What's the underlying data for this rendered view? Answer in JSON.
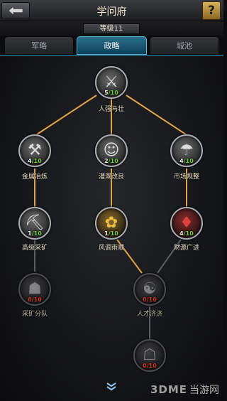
{
  "header": {
    "title": "学问府",
    "back_icon": "back-arrow-icon",
    "help_label": "?"
  },
  "level": {
    "label": "等级11"
  },
  "tabs": [
    {
      "label": "军略",
      "active": false
    },
    {
      "label": "政略",
      "active": true
    },
    {
      "label": "城池",
      "active": false
    }
  ],
  "tree": {
    "nodes": [
      {
        "id": "people",
        "label": "人强马壮",
        "current": "5",
        "max": "10",
        "locked": false,
        "icon": "warrior-portrait-icon"
      },
      {
        "id": "metal",
        "label": "金属冶炼",
        "current": "4",
        "max": "10",
        "locked": false,
        "icon": "smelting-icon"
      },
      {
        "id": "irrigation",
        "label": "灌溉改良",
        "current": "2",
        "max": "10",
        "locked": false,
        "icon": "farmer-icon"
      },
      {
        "id": "market",
        "label": "市场规整",
        "current": "4",
        "max": "10",
        "locked": false,
        "icon": "market-stall-icon"
      },
      {
        "id": "mining",
        "label": "高级采矿",
        "current": "1",
        "max": "10",
        "locked": false,
        "icon": "mining-icon"
      },
      {
        "id": "weather",
        "label": "风调雨顺",
        "current": "1",
        "max": "10",
        "locked": false,
        "icon": "wheat-icon"
      },
      {
        "id": "wealth",
        "label": "财源广进",
        "current": "4",
        "max": "10",
        "locked": false,
        "icon": "money-bag-icon"
      },
      {
        "id": "mining_team",
        "label": "采矿分队",
        "current": "0",
        "max": "10",
        "locked": true,
        "icon": "miner-team-icon"
      },
      {
        "id": "talent",
        "label": "人才济济",
        "current": "0",
        "max": "10",
        "locked": true,
        "icon": "scholar-icon"
      },
      {
        "id": "bottom",
        "label": "",
        "current": "0",
        "max": "10",
        "locked": true,
        "icon": "robed-figure-icon"
      }
    ]
  },
  "scroll_hint_icon": "double-chevron-down-icon",
  "watermark": {
    "logo": "3DME",
    "text": "当游网"
  },
  "colors": {
    "link_active": "#e0a449",
    "link_inactive": "#5a5d61",
    "tab_active": "#1d5f7e",
    "count_max": "#7ac943",
    "count_locked": "#d23a2a"
  }
}
